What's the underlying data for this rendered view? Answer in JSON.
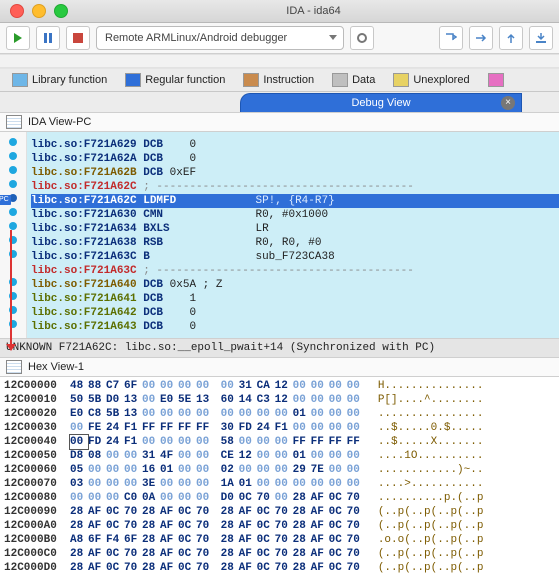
{
  "title": "IDA - ida64",
  "toolbar": {
    "debugger": "Remote ARMLinux/Android debugger"
  },
  "legend": {
    "lib": "Library function",
    "reg": "Regular function",
    "ins": "Instruction",
    "dat": "Data",
    "unx": "Unexplored"
  },
  "tab_debug": "Debug View",
  "view_title": "IDA View-PC",
  "hex_title": "Hex View-1",
  "status": "UNKNOWN  F721A62C: libc.so:__epoll_pwait+14  (Synchronized with PC)",
  "pc_label": "PC",
  "chart_data": null,
  "disasm": [
    {
      "a": "libc.so:F721A629",
      "c": "navy",
      "m": "DCB",
      "op": "   0"
    },
    {
      "a": "libc.so:F721A62A",
      "c": "navy",
      "m": "DCB",
      "op": "   0"
    },
    {
      "a": "libc.so:F721A62B",
      "c": "brown",
      "m": "DCB",
      "op": "0xEF"
    },
    {
      "a": "libc.so:F721A62C",
      "c": "red",
      "m": ";",
      "op": "---------------------------------------"
    },
    {
      "a": "libc.so:F721A62C",
      "c": "navy",
      "m": "LDMFD",
      "op": "           SP!, {R4-R7}",
      "hl": 1
    },
    {
      "a": "libc.so:F721A630",
      "c": "navy",
      "m": "CMN",
      "op": "             R0, #0x1000"
    },
    {
      "a": "libc.so:F721A634",
      "c": "navy",
      "m": "BXLS",
      "op": "            LR"
    },
    {
      "a": "libc.so:F721A638",
      "c": "navy",
      "m": "RSB",
      "op": "             R0, R0, #0"
    },
    {
      "a": "libc.so:F721A63C",
      "c": "navy",
      "m": "B",
      "op": "               sub_F723CA38"
    },
    {
      "a": "libc.so:F721A63C",
      "c": "red",
      "m": ";",
      "op": "---------------------------------------"
    },
    {
      "a": "libc.so:F721A640",
      "c": "brown",
      "m": "DCB",
      "op": "0x5A ; Z"
    },
    {
      "a": "libc.so:F721A641",
      "c": "olive",
      "m": "DCB",
      "op": "   1"
    },
    {
      "a": "libc.so:F721A642",
      "c": "olive",
      "m": "DCB",
      "op": "   0"
    },
    {
      "a": "libc.so:F721A643",
      "c": "olive",
      "m": "DCB",
      "op": "   0"
    }
  ],
  "hex": [
    {
      "a": "12C00000",
      "b": [
        "48",
        "88",
        "C7",
        "6F",
        "00",
        "00",
        "00",
        "00",
        "00",
        "31",
        "CA",
        "12",
        "00",
        "00",
        "00",
        "00"
      ],
      "asc": "H..............."
    },
    {
      "a": "12C00010",
      "b": [
        "50",
        "5B",
        "D0",
        "13",
        "00",
        "E0",
        "5E",
        "13",
        "60",
        "14",
        "C3",
        "12",
        "00",
        "00",
        "00",
        "00"
      ],
      "asc": "P[]....^........"
    },
    {
      "a": "12C00020",
      "b": [
        "E0",
        "C8",
        "5B",
        "13",
        "00",
        "00",
        "00",
        "00",
        "00",
        "00",
        "00",
        "00",
        "01",
        "00",
        "00",
        "00"
      ],
      "asc": "................"
    },
    {
      "a": "12C00030",
      "b": [
        "00",
        "FE",
        "24",
        "F1",
        "FF",
        "FF",
        "FF",
        "FF",
        "30",
        "FD",
        "24",
        "F1",
        "00",
        "00",
        "00",
        "00"
      ],
      "asc": "..$.....0.$....."
    },
    {
      "a": "12C00040",
      "b": [
        "00",
        "FD",
        "24",
        "F1",
        "00",
        "00",
        "00",
        "00",
        "58",
        "00",
        "00",
        "00",
        "FF",
        "FF",
        "FF",
        "FF"
      ],
      "asc": "..$.....X.......",
      "hl": 0
    },
    {
      "a": "12C00050",
      "b": [
        "D8",
        "08",
        "00",
        "00",
        "31",
        "4F",
        "00",
        "00",
        "CE",
        "12",
        "00",
        "00",
        "01",
        "00",
        "00",
        "00"
      ],
      "asc": "....1O.........."
    },
    {
      "a": "12C00060",
      "b": [
        "05",
        "00",
        "00",
        "00",
        "16",
        "01",
        "00",
        "00",
        "02",
        "00",
        "00",
        "00",
        "29",
        "7E",
        "00",
        "00"
      ],
      "asc": "............)~.."
    },
    {
      "a": "12C00070",
      "b": [
        "03",
        "00",
        "00",
        "00",
        "3E",
        "00",
        "00",
        "00",
        "1A",
        "01",
        "00",
        "00",
        "00",
        "00",
        "00",
        "00"
      ],
      "asc": "....>..........."
    },
    {
      "a": "12C00080",
      "b": [
        "00",
        "00",
        "00",
        "C0",
        "0A",
        "00",
        "00",
        "00",
        "D0",
        "0C",
        "70",
        "00",
        "28",
        "AF",
        "0C",
        "70"
      ],
      "asc": "..........p.(..p"
    },
    {
      "a": "12C00090",
      "b": [
        "28",
        "AF",
        "0C",
        "70",
        "28",
        "AF",
        "0C",
        "70",
        "28",
        "AF",
        "0C",
        "70",
        "28",
        "AF",
        "0C",
        "70"
      ],
      "asc": "(..p(..p(..p(..p"
    },
    {
      "a": "12C000A0",
      "b": [
        "28",
        "AF",
        "0C",
        "70",
        "28",
        "AF",
        "0C",
        "70",
        "28",
        "AF",
        "0C",
        "70",
        "28",
        "AF",
        "0C",
        "70"
      ],
      "asc": "(..p(..p(..p(..p"
    },
    {
      "a": "12C000B0",
      "b": [
        "A8",
        "6F",
        "F4",
        "6F",
        "28",
        "AF",
        "0C",
        "70",
        "28",
        "AF",
        "0C",
        "70",
        "28",
        "AF",
        "0C",
        "70"
      ],
      "asc": ".o.o(..p(..p(..p"
    },
    {
      "a": "12C000C0",
      "b": [
        "28",
        "AF",
        "0C",
        "70",
        "28",
        "AF",
        "0C",
        "70",
        "28",
        "AF",
        "0C",
        "70",
        "28",
        "AF",
        "0C",
        "70"
      ],
      "asc": "(..p(..p(..p(..p"
    },
    {
      "a": "12C000D0",
      "b": [
        "28",
        "AF",
        "0C",
        "70",
        "28",
        "AF",
        "0C",
        "70",
        "28",
        "AF",
        "0C",
        "70",
        "28",
        "AF",
        "0C",
        "70"
      ],
      "asc": "(..p(..p(..p(..p"
    }
  ]
}
